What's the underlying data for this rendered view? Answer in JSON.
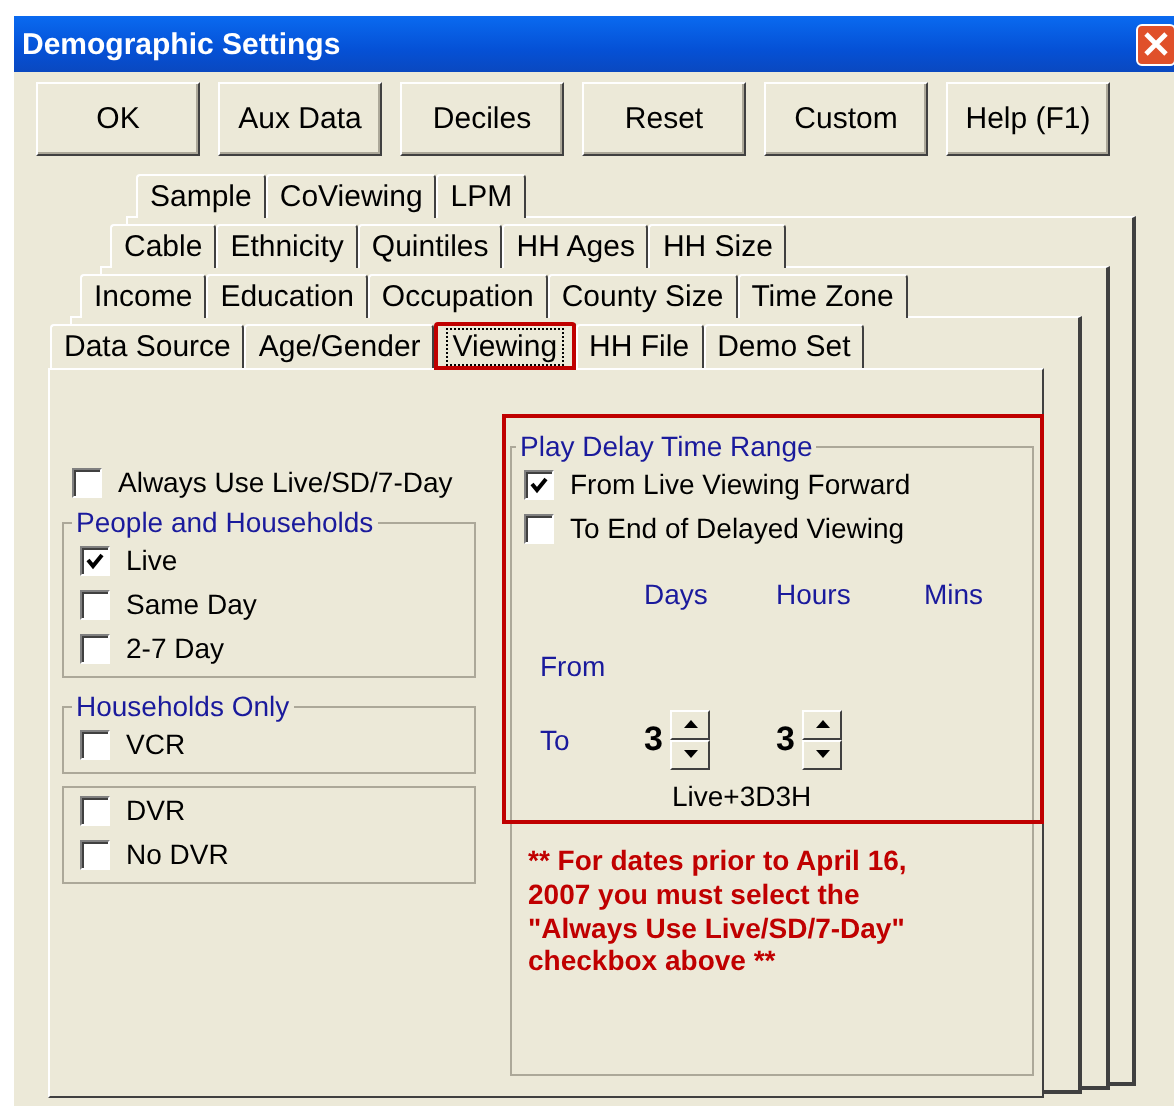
{
  "window": {
    "title": "Demographic Settings"
  },
  "buttons": [
    "OK",
    "Aux Data",
    "Deciles",
    "Reset",
    "Custom",
    "Help (F1)"
  ],
  "tab_rows": [
    {
      "tabs": [
        {
          "label": "Sample",
          "selected": false,
          "highlighted": false
        },
        {
          "label": "CoViewing",
          "selected": false,
          "highlighted": false
        },
        {
          "label": "LPM",
          "selected": false,
          "highlighted": false
        }
      ]
    },
    {
      "tabs": [
        {
          "label": "Cable",
          "selected": false,
          "highlighted": false
        },
        {
          "label": "Ethnicity",
          "selected": false,
          "highlighted": false
        },
        {
          "label": "Quintiles",
          "selected": false,
          "highlighted": false
        },
        {
          "label": "HH Ages",
          "selected": false,
          "highlighted": false
        },
        {
          "label": "HH Size",
          "selected": false,
          "highlighted": false
        }
      ]
    },
    {
      "tabs": [
        {
          "label": "Income",
          "selected": false,
          "highlighted": false
        },
        {
          "label": "Education",
          "selected": false,
          "highlighted": false
        },
        {
          "label": "Occupation",
          "selected": false,
          "highlighted": false
        },
        {
          "label": "County Size",
          "selected": false,
          "highlighted": false
        },
        {
          "label": "Time Zone",
          "selected": false,
          "highlighted": false
        }
      ]
    },
    {
      "tabs": [
        {
          "label": "Data Source",
          "selected": false,
          "highlighted": false
        },
        {
          "label": "Age/Gender",
          "selected": false,
          "highlighted": false
        },
        {
          "label": "Viewing",
          "selected": true,
          "highlighted": true
        },
        {
          "label": "HH File",
          "selected": false,
          "highlighted": false
        },
        {
          "label": "Demo Set",
          "selected": false,
          "highlighted": false
        }
      ]
    }
  ],
  "always_use": {
    "label": "Always Use Live/SD/7-Day",
    "checked": false
  },
  "groups": [
    {
      "title": "People and Households",
      "options": [
        {
          "label": "Live",
          "checked": true
        },
        {
          "label": "Same Day",
          "checked": false
        },
        {
          "label": "2-7 Day",
          "checked": false
        }
      ]
    },
    {
      "title": "Households Only",
      "options": [
        {
          "label": "VCR",
          "checked": false
        }
      ]
    },
    {
      "options": [
        {
          "label": "DVR",
          "checked": false
        },
        {
          "label": "No DVR",
          "checked": false
        }
      ]
    }
  ],
  "play_delay": {
    "title": "Play Delay Time Range",
    "highlighted": true,
    "options": [
      {
        "label": "From Live Viewing Forward",
        "checked": true
      },
      {
        "label": "To End of Delayed Viewing",
        "checked": false
      }
    ],
    "columns": [
      "Days",
      "Hours",
      "Mins"
    ],
    "rows": [
      {
        "label": "From",
        "values": []
      },
      {
        "label": "To",
        "values": [
          "3",
          "3"
        ]
      }
    ],
    "summary": "Live+3D3H"
  },
  "note": "** For dates prior to April 16, 2007 you must select the \"Always Use Live/SD/7-Day\" checkbox above **"
}
